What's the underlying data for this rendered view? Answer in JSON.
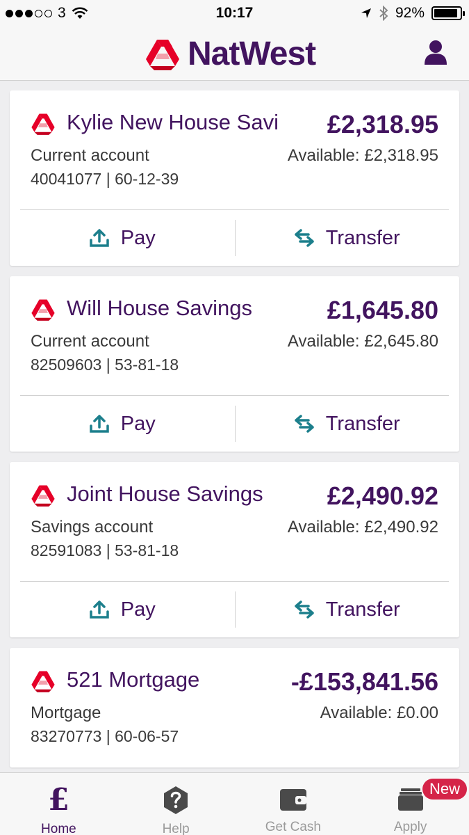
{
  "status_bar": {
    "carrier": "3",
    "time": "10:17",
    "battery": "92%",
    "battery_level": 0.92
  },
  "header": {
    "brand": "NatWest"
  },
  "accounts": [
    {
      "name": "Kylie New House Savi",
      "balance": "£2,318.95",
      "type": "Current account",
      "available": "Available: £2,318.95",
      "number": "40041077 | 60-12-39",
      "actions": {
        "pay": "Pay",
        "transfer": "Transfer"
      }
    },
    {
      "name": "Will House Savings",
      "balance": "£1,645.80",
      "type": "Current account",
      "available": "Available: £2,645.80",
      "number": "82509603 | 53-81-18",
      "actions": {
        "pay": "Pay",
        "transfer": "Transfer"
      }
    },
    {
      "name": "Joint House Savings",
      "balance": "£2,490.92",
      "type": "Savings account",
      "available": "Available: £2,490.92",
      "number": "82591083 | 53-81-18",
      "actions": {
        "pay": "Pay",
        "transfer": "Transfer"
      }
    },
    {
      "name": "521 Mortgage",
      "balance": "-£153,841.56",
      "type": "Mortgage",
      "available": "Available: £0.00",
      "number": "83270773 | 60-06-57"
    }
  ],
  "tabs": [
    {
      "label": "Home",
      "icon": "pound-icon",
      "active": true
    },
    {
      "label": "Help",
      "icon": "help-icon"
    },
    {
      "label": "Get Cash",
      "icon": "wallet-icon"
    },
    {
      "label": "Apply",
      "icon": "apply-icon",
      "badge": "New"
    }
  ],
  "colors": {
    "brand_purple": "#42145f",
    "brand_red": "#e60028",
    "action_teal": "#1c7f8c",
    "badge_red": "#d52448"
  }
}
